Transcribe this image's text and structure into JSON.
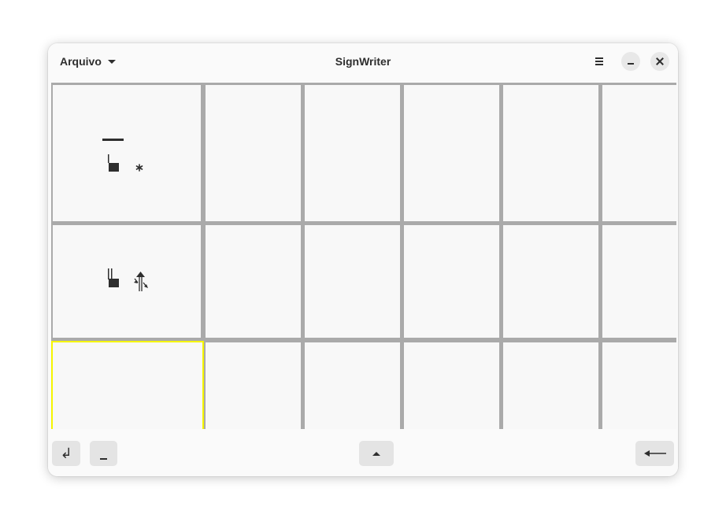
{
  "window": {
    "title": "SignWriter",
    "menu_label": "Arquivo"
  },
  "icons": {
    "menu": "hamburger-icon",
    "minimize": "minimize-icon",
    "close": "close-icon",
    "return": "return-arrow-icon",
    "space": "space-icon",
    "up": "triangle-up-icon",
    "backspace": "long-left-arrow-icon"
  },
  "bottombar": {
    "return_glyph": "↲"
  },
  "grid": {
    "rows": 3,
    "columns": 6,
    "selected_cell": [
      2,
      0
    ]
  },
  "colors": {
    "selection": "#f5f500",
    "grid_lines": "#aaaaaa",
    "symbol": "#2e2e2e"
  }
}
